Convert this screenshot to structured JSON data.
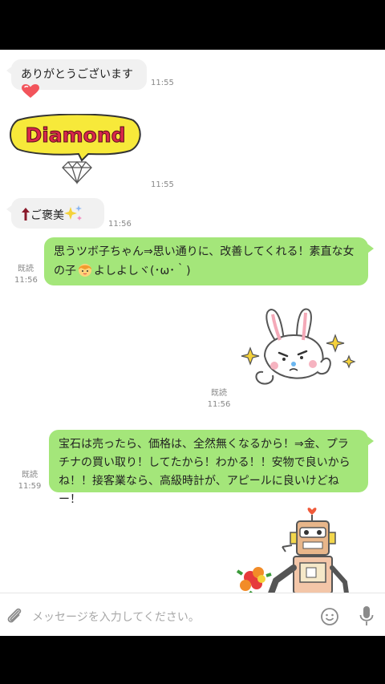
{
  "messages": {
    "m1": {
      "text": "ありがとうございます",
      "time": "11:55"
    },
    "m2": {
      "sticker_text": "Diamond",
      "time": "11:55"
    },
    "m3": {
      "text": "ご褒美",
      "time": "11:56"
    },
    "m4": {
      "text": "思うツボ子ちゃん⇒思い通りに、改善してくれる！素直な女の子",
      "text_tail": "よしよしヾ(･ω･｀)",
      "read": "既読",
      "time": "11:56"
    },
    "m5": {
      "read": "既読",
      "time": "11:56"
    },
    "m6": {
      "text": "宝石は売ったら、価格は、全然無くなるから！⇒金、プラチナの買い取り！してたから！わかる！！安物で良いからね！！接客業なら、高級時計が、アピールに良いけどねー！",
      "read": "既読",
      "time": "11:59"
    }
  },
  "composer": {
    "placeholder": "メッセージを入力してください。"
  },
  "colors": {
    "outgoing": "#a4e67a",
    "incoming": "#f1f1f1",
    "heart": "#f2545b"
  }
}
